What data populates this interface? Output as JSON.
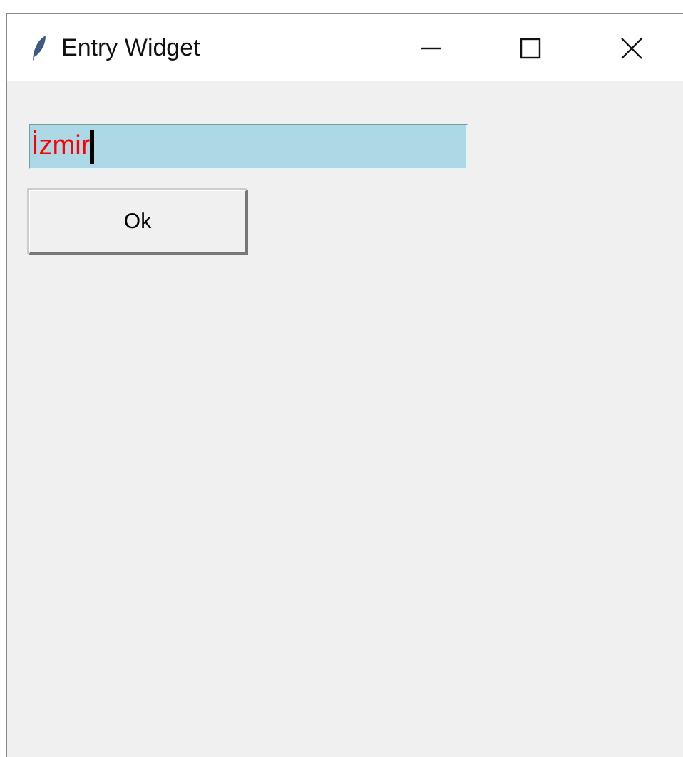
{
  "window": {
    "title": "Entry Widget"
  },
  "entry": {
    "value": "İzmir"
  },
  "buttons": [
    "Ok"
  ]
}
